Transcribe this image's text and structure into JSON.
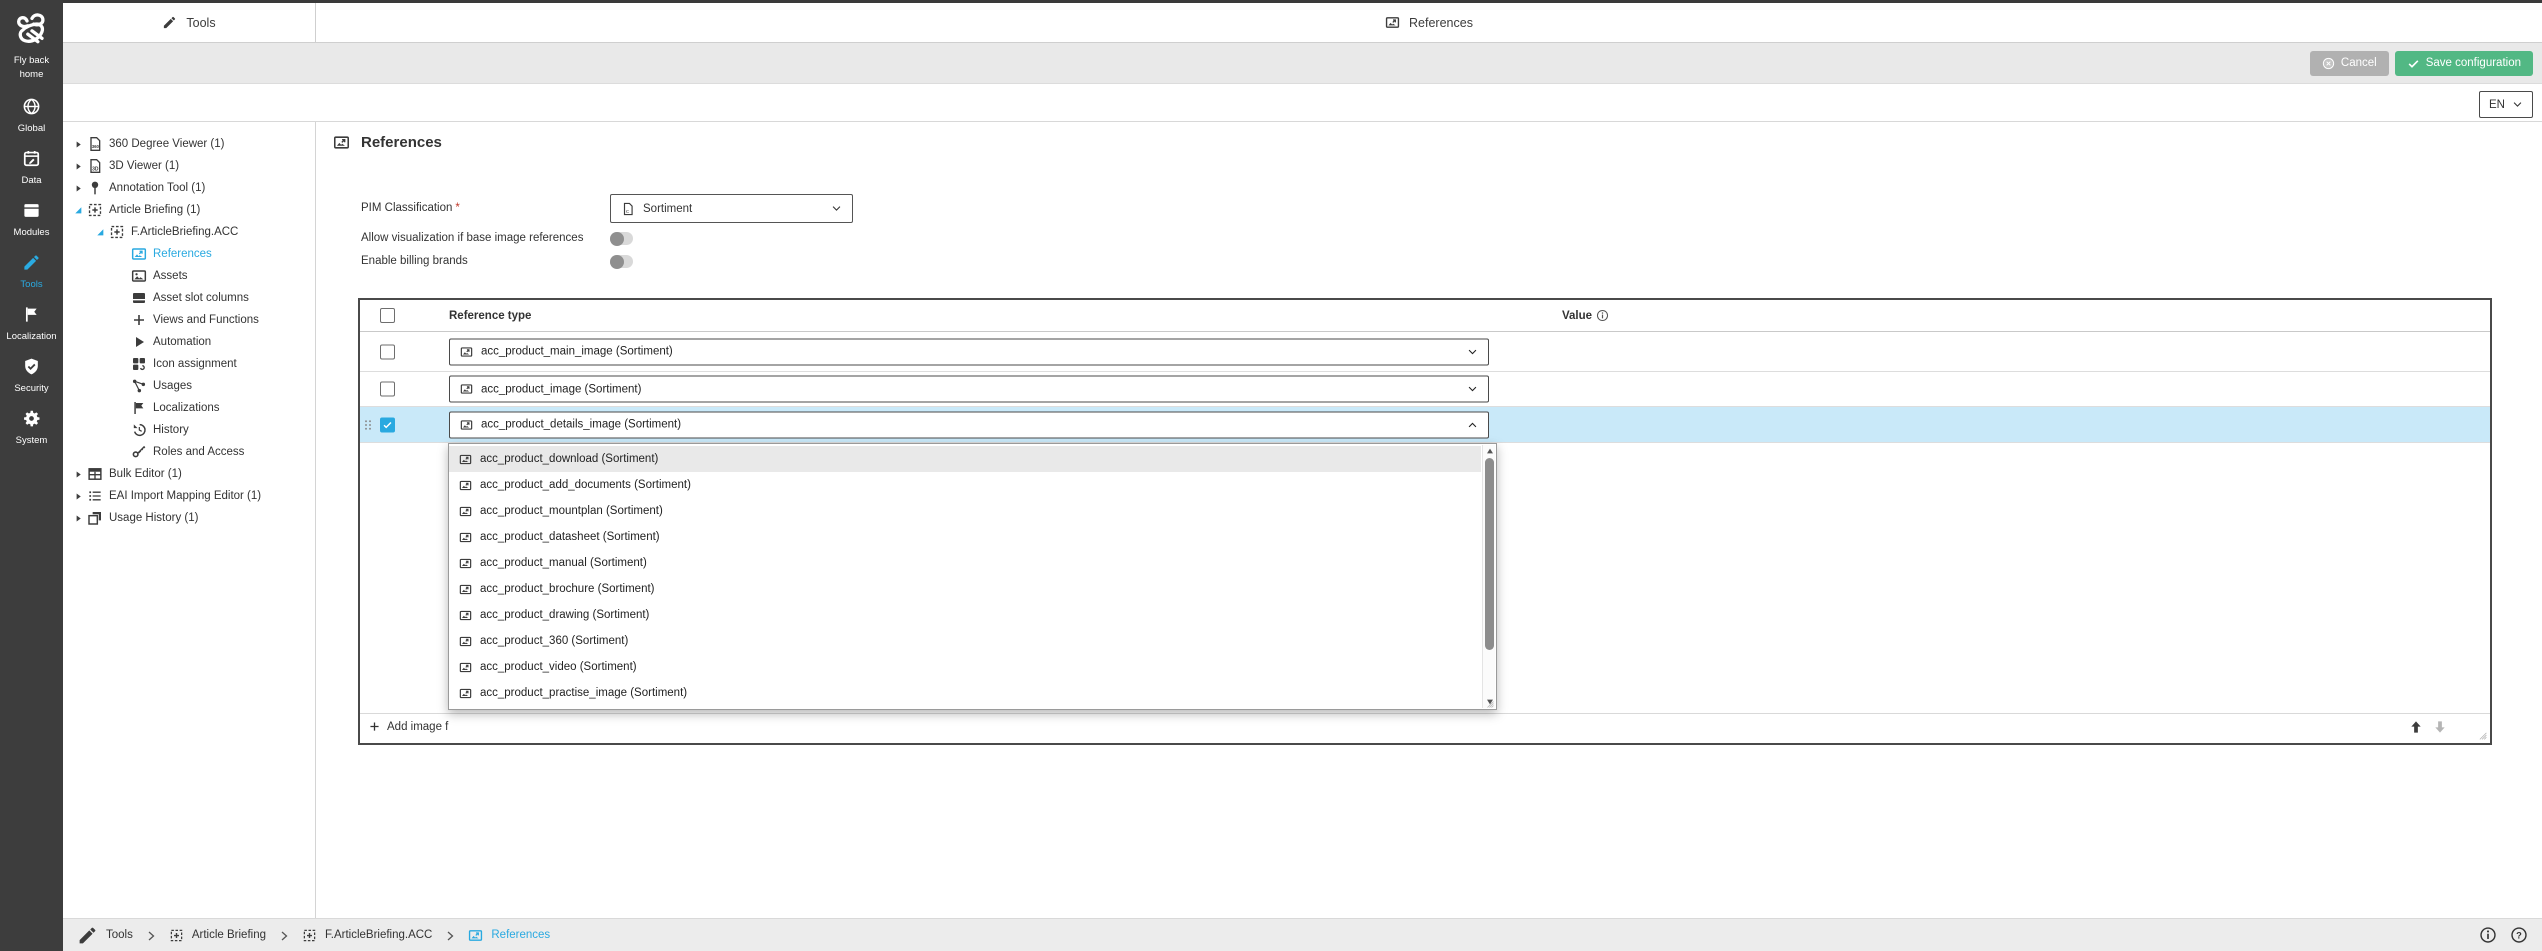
{
  "rail": {
    "logo_label": "Fly back home",
    "logo_icon": "bee",
    "items": [
      {
        "label": "Global",
        "icon": "globe",
        "active": false
      },
      {
        "label": "Data",
        "icon": "calendar-edit",
        "active": false
      },
      {
        "label": "Modules",
        "icon": "box",
        "active": false
      },
      {
        "label": "Tools",
        "icon": "pencil",
        "active": true
      },
      {
        "label": "Localization",
        "icon": "flag",
        "active": false
      },
      {
        "label": "Security",
        "icon": "shield-check",
        "active": false
      },
      {
        "label": "System",
        "icon": "gear",
        "active": false
      }
    ]
  },
  "tabs": {
    "left": {
      "label": "Tools",
      "icon": "pencil"
    },
    "right": {
      "label": "References",
      "icon": "image-ref"
    }
  },
  "toolbar": {
    "cancel_label": "Cancel",
    "save_label": "Save configuration"
  },
  "language": {
    "value": "EN"
  },
  "tree": {
    "items": [
      {
        "label": "360 Degree Viewer (1)",
        "icon": "doc-360",
        "level": 0,
        "arrow": "collapsed",
        "selected": false
      },
      {
        "label": "3D Viewer (1)",
        "icon": "doc-3d",
        "level": 0,
        "arrow": "collapsed",
        "selected": false
      },
      {
        "label": "Annotation Tool (1)",
        "icon": "pin",
        "level": 0,
        "arrow": "collapsed",
        "selected": false
      },
      {
        "label": "Article Briefing (1)",
        "icon": "grid-plus",
        "level": 0,
        "arrow": "expanded",
        "selected": false
      },
      {
        "label": "F.ArticleBriefing.ACC",
        "icon": "grid-plus",
        "level": 1,
        "arrow": "expanded",
        "selected": false
      },
      {
        "label": "References",
        "icon": "image-ref",
        "level": 2,
        "arrow": "none",
        "selected": true
      },
      {
        "label": "Assets",
        "icon": "image",
        "level": 2,
        "arrow": "none",
        "selected": false
      },
      {
        "label": "Asset slot columns",
        "icon": "columns",
        "level": 2,
        "arrow": "none",
        "selected": false
      },
      {
        "label": "Views and Functions",
        "icon": "plus",
        "level": 2,
        "arrow": "none",
        "selected": false
      },
      {
        "label": "Automation",
        "icon": "play",
        "level": 2,
        "arrow": "none",
        "selected": false
      },
      {
        "label": "Icon assignment",
        "icon": "grid-dots",
        "level": 2,
        "arrow": "none",
        "selected": false
      },
      {
        "label": "Usages",
        "icon": "share",
        "level": 2,
        "arrow": "none",
        "selected": false
      },
      {
        "label": "Localizations",
        "icon": "flag",
        "level": 2,
        "arrow": "none",
        "selected": false
      },
      {
        "label": "History",
        "icon": "history",
        "level": 2,
        "arrow": "none",
        "selected": false
      },
      {
        "label": "Roles and Access",
        "icon": "key",
        "level": 2,
        "arrow": "none",
        "selected": false
      },
      {
        "label": "Bulk Editor (1)",
        "icon": "table",
        "level": 0,
        "arrow": "collapsed",
        "selected": false
      },
      {
        "label": "EAI Import Mapping Editor (1)",
        "icon": "list",
        "level": 0,
        "arrow": "collapsed",
        "selected": false
      },
      {
        "label": "Usage History (1)",
        "icon": "copy",
        "level": 0,
        "arrow": "collapsed",
        "selected": false
      }
    ]
  },
  "main": {
    "title": "References",
    "title_icon": "image-ref",
    "pim_classification": {
      "label": "PIM Classification",
      "required_mark": "*",
      "value": "Sortiment",
      "icon": "doc-c"
    },
    "toggles": [
      {
        "label": "Allow visualization if base image references",
        "on": false
      },
      {
        "label": "Enable billing brands",
        "on": false
      }
    ],
    "table": {
      "columns": {
        "reference_type": "Reference type",
        "value": "Value"
      },
      "rows": [
        {
          "value": "acc_product_main_image (Sortiment)",
          "checked": false,
          "open": false,
          "selected": false
        },
        {
          "value": "acc_product_image (Sortiment)",
          "checked": false,
          "open": false,
          "selected": false
        },
        {
          "value": "acc_product_details_image (Sortiment)",
          "checked": true,
          "open": true,
          "selected": true
        }
      ],
      "add_button_label": "Add image f",
      "dropdown_options": [
        {
          "label": "acc_product_download (Sortiment)",
          "hover": true
        },
        {
          "label": "acc_product_add_documents (Sortiment)",
          "hover": false
        },
        {
          "label": "acc_product_mountplan (Sortiment)",
          "hover": false
        },
        {
          "label": "acc_product_datasheet (Sortiment)",
          "hover": false
        },
        {
          "label": "acc_product_manual (Sortiment)",
          "hover": false
        },
        {
          "label": "acc_product_brochure (Sortiment)",
          "hover": false
        },
        {
          "label": "acc_product_drawing (Sortiment)",
          "hover": false
        },
        {
          "label": "acc_product_360 (Sortiment)",
          "hover": false
        },
        {
          "label": "acc_product_video (Sortiment)",
          "hover": false
        },
        {
          "label": "acc_product_practise_image (Sortiment)",
          "hover": false
        }
      ]
    }
  },
  "breadcrumb": {
    "items": [
      {
        "label": "Tools",
        "icon": "pencil",
        "big": true,
        "active": false
      },
      {
        "label": "Article Briefing",
        "icon": "grid-plus",
        "big": false,
        "active": false
      },
      {
        "label": "F.ArticleBriefing.ACC",
        "icon": "grid-plus",
        "big": false,
        "active": false
      },
      {
        "label": "References",
        "icon": "image-ref",
        "big": false,
        "active": true
      }
    ]
  },
  "colors": {
    "accent_blue": "#29a9e0",
    "save_green": "#52b884",
    "cancel_gray": "#b1b1b1",
    "rail_bg": "#3d3d3d",
    "selected_row": "#c9e9f9"
  }
}
